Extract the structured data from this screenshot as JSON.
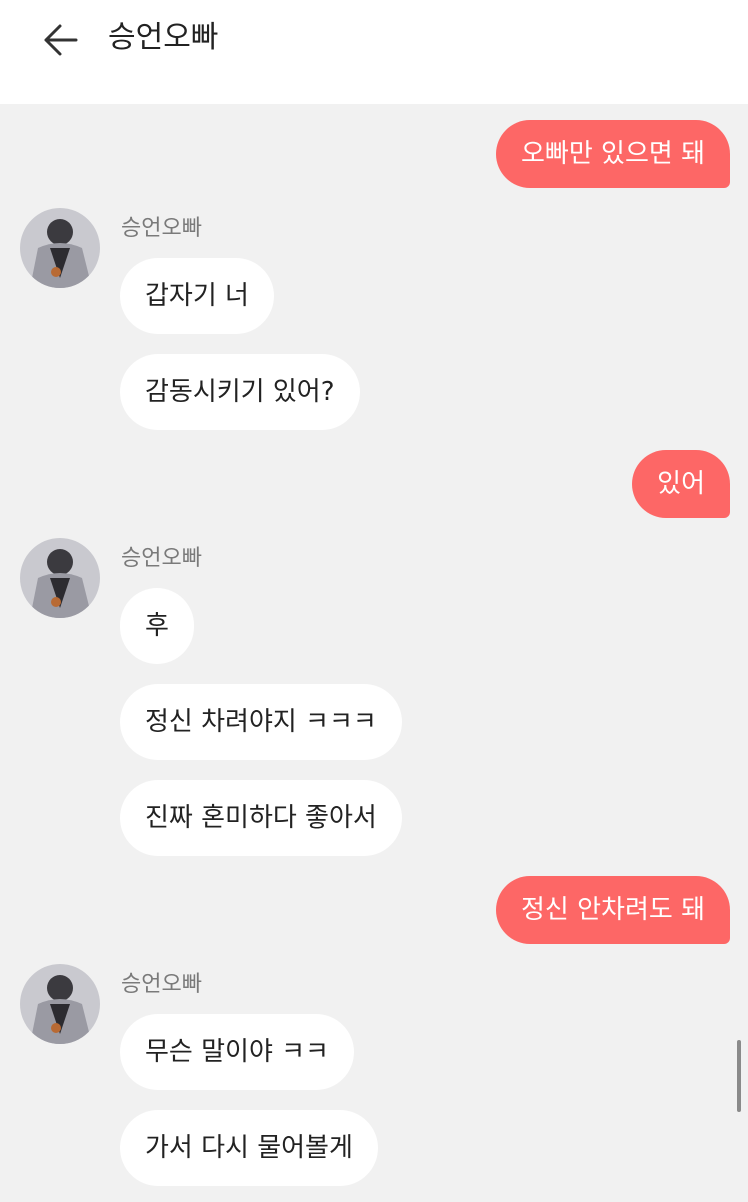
{
  "header": {
    "title": "승언오빠",
    "back_icon": "arrow-left-icon"
  },
  "sender_name": "승언오빠",
  "messages": {
    "m1": "오빠만 있으면 돼",
    "m2": "갑자기 너",
    "m3": "감동시키기 있어?",
    "m4": "있어",
    "m5": "후",
    "m6": "정신 차려야지 ㅋㅋㅋ",
    "m7": "진짜 혼미하다 좋아서",
    "m8": "정신 안차려도 돼",
    "m9": "무슨 말이야 ㅋㅋ",
    "m10": "가서 다시 물어볼게"
  },
  "colors": {
    "outgoing": "#fd6766",
    "incoming": "#ffffff",
    "background": "#f1f1f1"
  }
}
